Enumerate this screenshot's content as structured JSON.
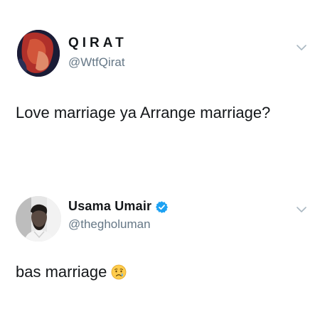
{
  "tweets": [
    {
      "display_name": "QIRAT",
      "handle": "@WtfQirat",
      "text": "Love marriage ya Arrange marriage?",
      "avatar_icon": "profile-photo",
      "menu_icon": "chevron-down-icon"
    },
    {
      "display_name": "Usama Umair",
      "handle": "@thegholuman",
      "text": "bas marriage",
      "verified": true,
      "emoji_icon": "crying-face-emoji",
      "avatar_icon": "profile-photo",
      "menu_icon": "chevron-down-icon"
    }
  ],
  "colors": {
    "text": "#14171a",
    "handle": "#657786",
    "verified": "#1da1f2",
    "chevron": "#aab8c2"
  }
}
